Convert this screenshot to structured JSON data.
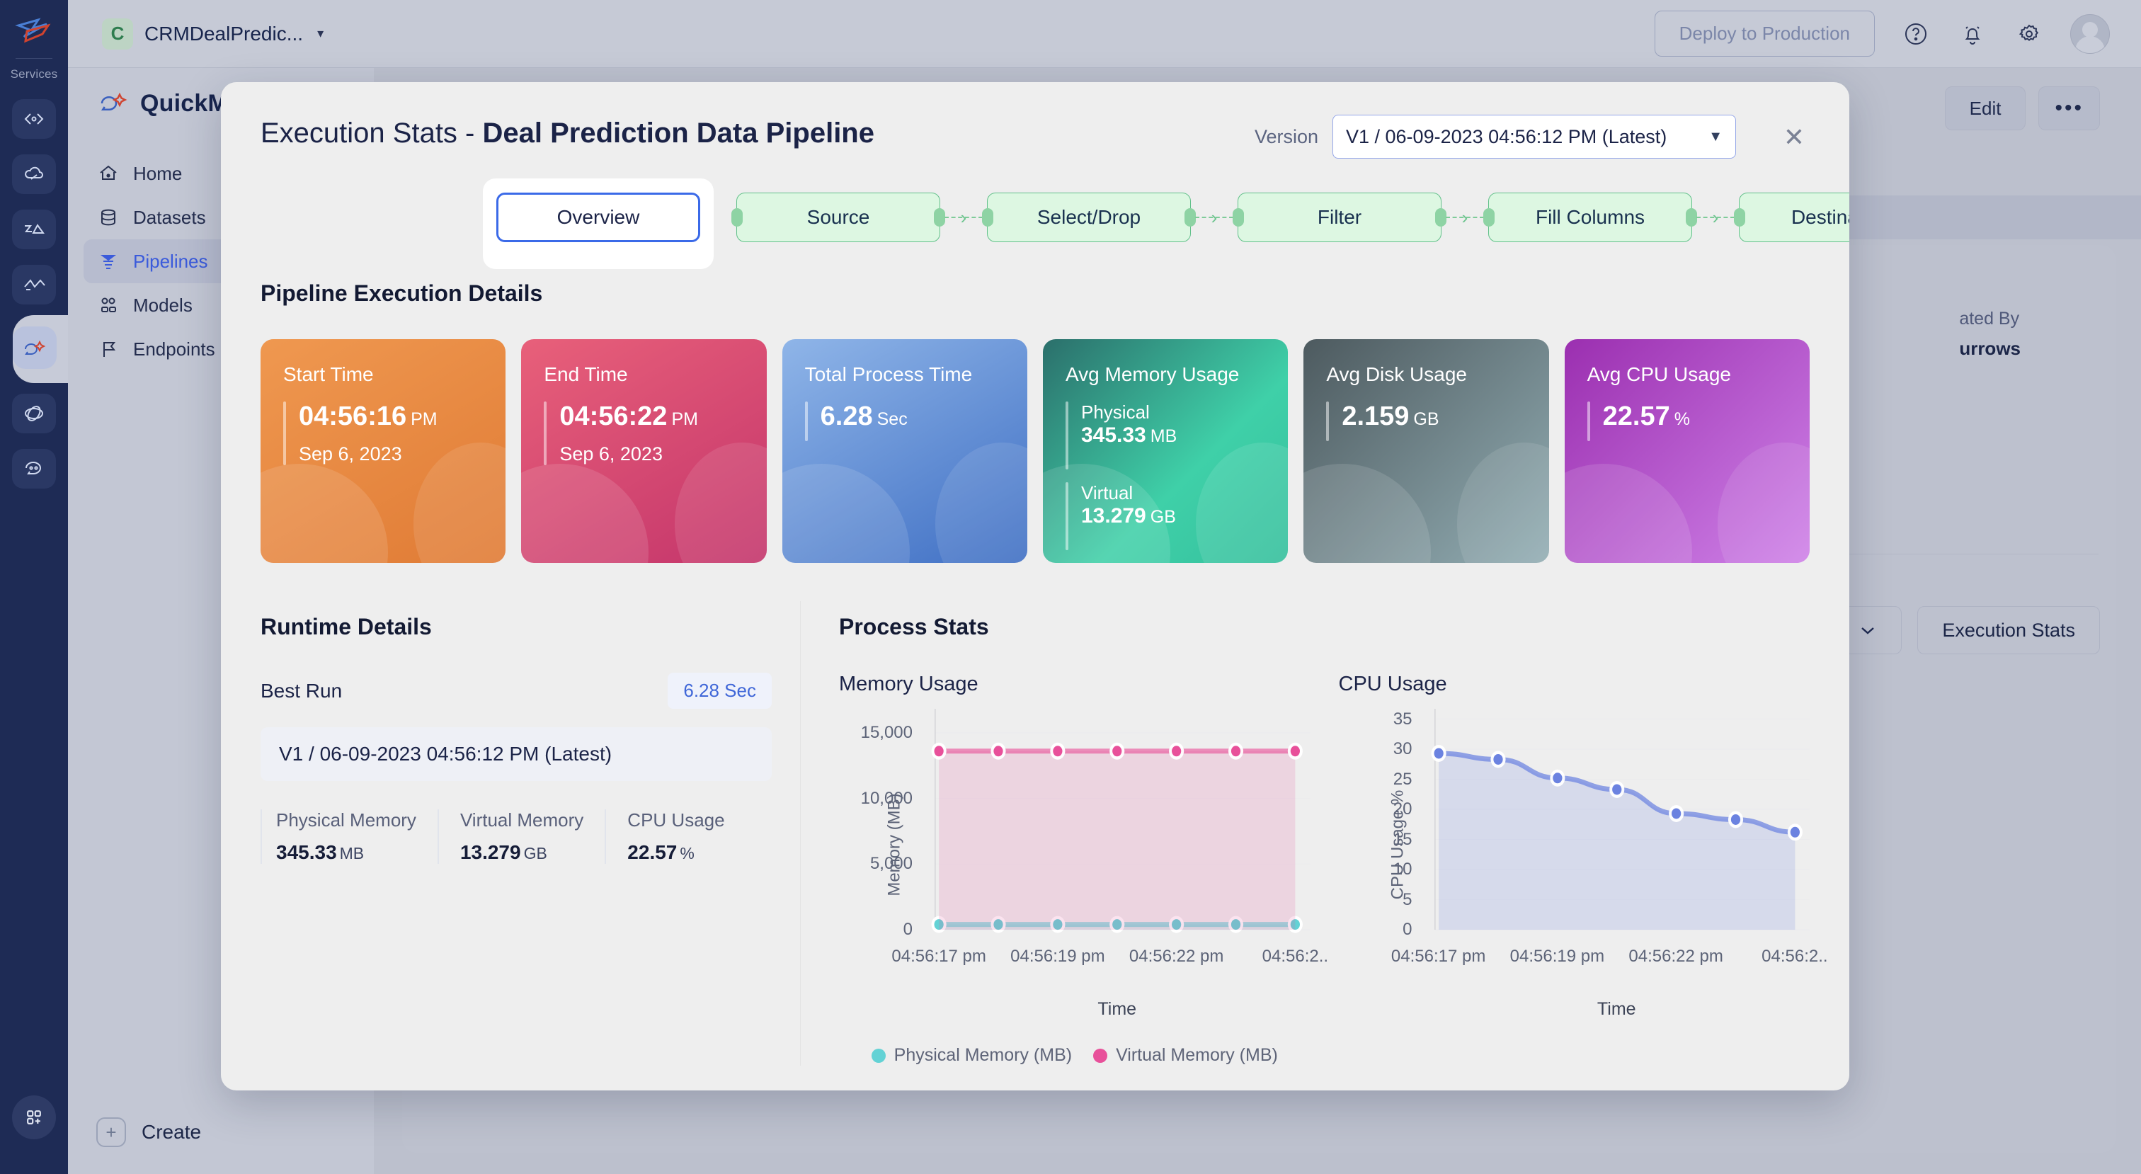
{
  "rail": {
    "section_label": "Services"
  },
  "sidebar": {
    "brand": "QuickML",
    "items": [
      {
        "label": "Home",
        "icon": "home-icon"
      },
      {
        "label": "Datasets",
        "icon": "database-icon"
      },
      {
        "label": "Pipelines",
        "icon": "pipeline-icon"
      },
      {
        "label": "Models",
        "icon": "models-icon"
      },
      {
        "label": "Endpoints",
        "icon": "flag-icon"
      }
    ],
    "create_label": "Create"
  },
  "topbar": {
    "project_initial": "C",
    "project_name": "CRMDealPredic...",
    "deploy_label": "Deploy to Production",
    "icons": [
      "help-icon",
      "bell-icon",
      "gear-icon",
      "avatar"
    ]
  },
  "background": {
    "edit_label": "Edit",
    "more_label": "•••",
    "meta_label": "ated By",
    "meta_value": "urrows",
    "execution_stats_label": "Execution Stats"
  },
  "modal": {
    "title_prefix": "Execution Stats - ",
    "title_name": "Deal Prediction Data Pipeline",
    "version_label": "Version",
    "version_value": "V1 / 06-09-2023 04:56:12 PM (Latest)",
    "close_icon": "close-icon",
    "steps": {
      "overview": "Overview",
      "chain": [
        "Source",
        "Select/Drop",
        "Filter",
        "Fill Columns",
        "Destination"
      ]
    },
    "section_title": "Pipeline Execution Details",
    "cards": [
      {
        "title": "Start Time",
        "value": "04:56:16",
        "unit": "PM",
        "sub": "Sep 6, 2023",
        "theme": "c-start"
      },
      {
        "title": "End Time",
        "value": "04:56:22",
        "unit": "PM",
        "sub": "Sep 6, 2023",
        "theme": "c-end"
      },
      {
        "title": "Total Process Time",
        "value": "6.28",
        "unit": "Sec",
        "sub": "",
        "theme": "c-total"
      },
      {
        "title": "Avg Memory Usage",
        "rows": [
          {
            "label": "Physical",
            "value": "345.33",
            "unit": "MB"
          },
          {
            "label": "Virtual",
            "value": "13.279",
            "unit": "GB"
          }
        ],
        "theme": "c-mem"
      },
      {
        "title": "Avg Disk Usage",
        "value": "2.159",
        "unit": "GB",
        "sub": "",
        "theme": "c-disk"
      },
      {
        "title": "Avg CPU Usage",
        "value": "22.57",
        "unit": "%",
        "sub": "",
        "theme": "c-cpu"
      }
    ],
    "runtime": {
      "heading": "Runtime Details",
      "best_run_label": "Best Run",
      "best_run_value": "6.28 Sec",
      "version_value": "V1 / 06-09-2023 04:56:12 PM (Latest)",
      "metrics": [
        {
          "label": "Physical Memory",
          "value": "345.33",
          "unit": "MB"
        },
        {
          "label": "Virtual Memory",
          "value": "13.279",
          "unit": "GB"
        },
        {
          "label": "CPU Usage",
          "value": "22.57",
          "unit": "%"
        }
      ]
    },
    "process": {
      "heading": "Process Stats"
    }
  },
  "colors": {
    "accent_blue": "#3b6ae8",
    "step_green_border": "#62c08a",
    "step_green_fill": "#ddf7e2",
    "physical_memory": "#63d2d5",
    "virtual_memory": "#e8509a",
    "cpu_line": "#6b82e0"
  },
  "chart_data": [
    {
      "type": "line",
      "title": "Memory Usage",
      "xlabel": "Time",
      "ylabel": "Memory (MB)",
      "ylim": [
        0,
        16500
      ],
      "yticks": [
        0,
        5000,
        10000,
        15000
      ],
      "ytick_labels": [
        "0",
        "5,000",
        "10,000",
        "15,000"
      ],
      "grid": true,
      "legend_position": "bottom",
      "x": [
        "04:56:17 pm",
        "04:56:18 pm",
        "04:56:19 pm",
        "04:56:20 pm",
        "04:56:22 pm",
        "04:56:23 pm",
        "04:56:2.."
      ],
      "xtick_labels": [
        "04:56:17 pm",
        "04:56:19 pm",
        "04:56:22 pm",
        "04:56:2.."
      ],
      "xtick_positions": [
        0,
        2,
        4,
        6
      ],
      "series": [
        {
          "name": "Physical Memory (MB)",
          "color": "#63d2d5",
          "values": [
            400,
            400,
            400,
            400,
            400,
            400,
            400
          ]
        },
        {
          "name": "Virtual Memory (MB)",
          "color": "#e8509a",
          "values": [
            13600,
            13600,
            13600,
            13600,
            13600,
            13600,
            13600
          ]
        }
      ]
    },
    {
      "type": "line",
      "title": "CPU Usage",
      "xlabel": "Time",
      "ylabel": "CPU Usage %",
      "ylim": [
        0,
        36
      ],
      "yticks": [
        0,
        5,
        10,
        15,
        20,
        25,
        30,
        35
      ],
      "ytick_labels": [
        "0",
        "5",
        "10",
        "15",
        "20",
        "25",
        "30",
        "35"
      ],
      "grid": true,
      "legend_position": "none",
      "x": [
        "04:56:17 pm",
        "04:56:18 pm",
        "04:56:19 pm",
        "04:56:20 pm",
        "04:56:22 pm",
        "04:56:23 pm",
        "04:56:2.."
      ],
      "xtick_labels": [
        "04:56:17 pm",
        "04:56:19 pm",
        "04:56:22 pm",
        "04:56:2.."
      ],
      "xtick_positions": [
        0,
        2,
        4,
        6
      ],
      "series": [
        {
          "name": "CPU Usage %",
          "color": "#6b82e0",
          "values": [
            29.3,
            28.3,
            25.2,
            23.3,
            19.3,
            18.3,
            16.2
          ]
        }
      ]
    }
  ]
}
